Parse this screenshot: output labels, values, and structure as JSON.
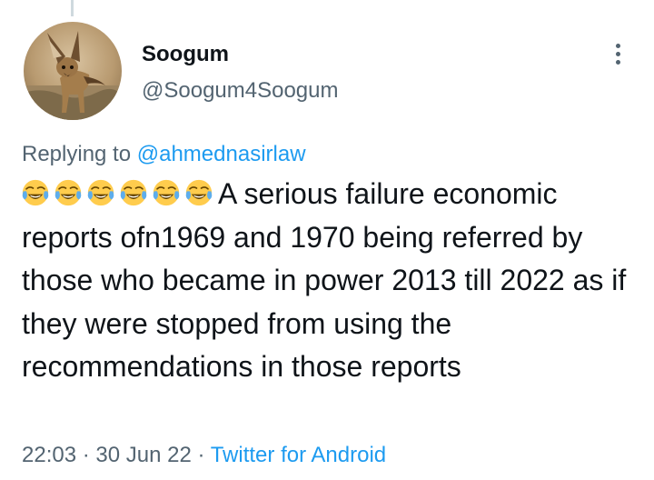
{
  "user": {
    "display_name": "Soogum",
    "handle": "@Soogum4Soogum"
  },
  "reply": {
    "prefix": "Replying to ",
    "to_handle": "@ahmednasirlaw"
  },
  "tweet": {
    "emoji": [
      "face-with-tears-of-joy",
      "face-with-tears-of-joy",
      "face-with-tears-of-joy",
      "face-with-tears-of-joy",
      "face-with-tears-of-joy",
      "face-with-tears-of-joy"
    ],
    "text": "A serious failure economic reports ofn1969 and 1970 being referred by those who became in power 2013 till 2022 as if they were stopped from using the recommendations in those reports"
  },
  "meta": {
    "time": "22:03",
    "separator": " · ",
    "date": "30 Jun 22",
    "source": "Twitter for Android"
  },
  "colors": {
    "link": "#1d9bf0",
    "secondary_text": "#536471",
    "primary_text": "#0f1419"
  },
  "icons": {
    "more": "more-vertical-icon",
    "avatar": "bat-eared-fox-photo"
  }
}
